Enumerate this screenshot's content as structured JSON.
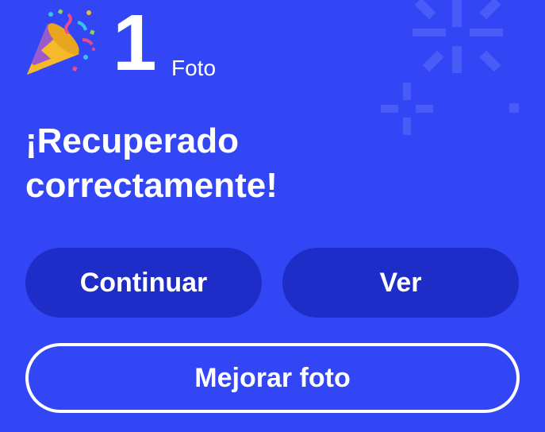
{
  "result": {
    "count": "1",
    "unit": "Foto",
    "title_line1": "¡Recuperado",
    "title_line2": "correctamente!"
  },
  "actions": {
    "continue_label": "Continuar",
    "view_label": "Ver",
    "enhance_label": "Mejorar foto"
  },
  "icons": {
    "celebration": "party-popper-icon",
    "background": "sparkle-burst-icon"
  },
  "colors": {
    "background": "#3346F5",
    "button_fill": "#1F2DC8",
    "text": "#FFFFFF"
  }
}
